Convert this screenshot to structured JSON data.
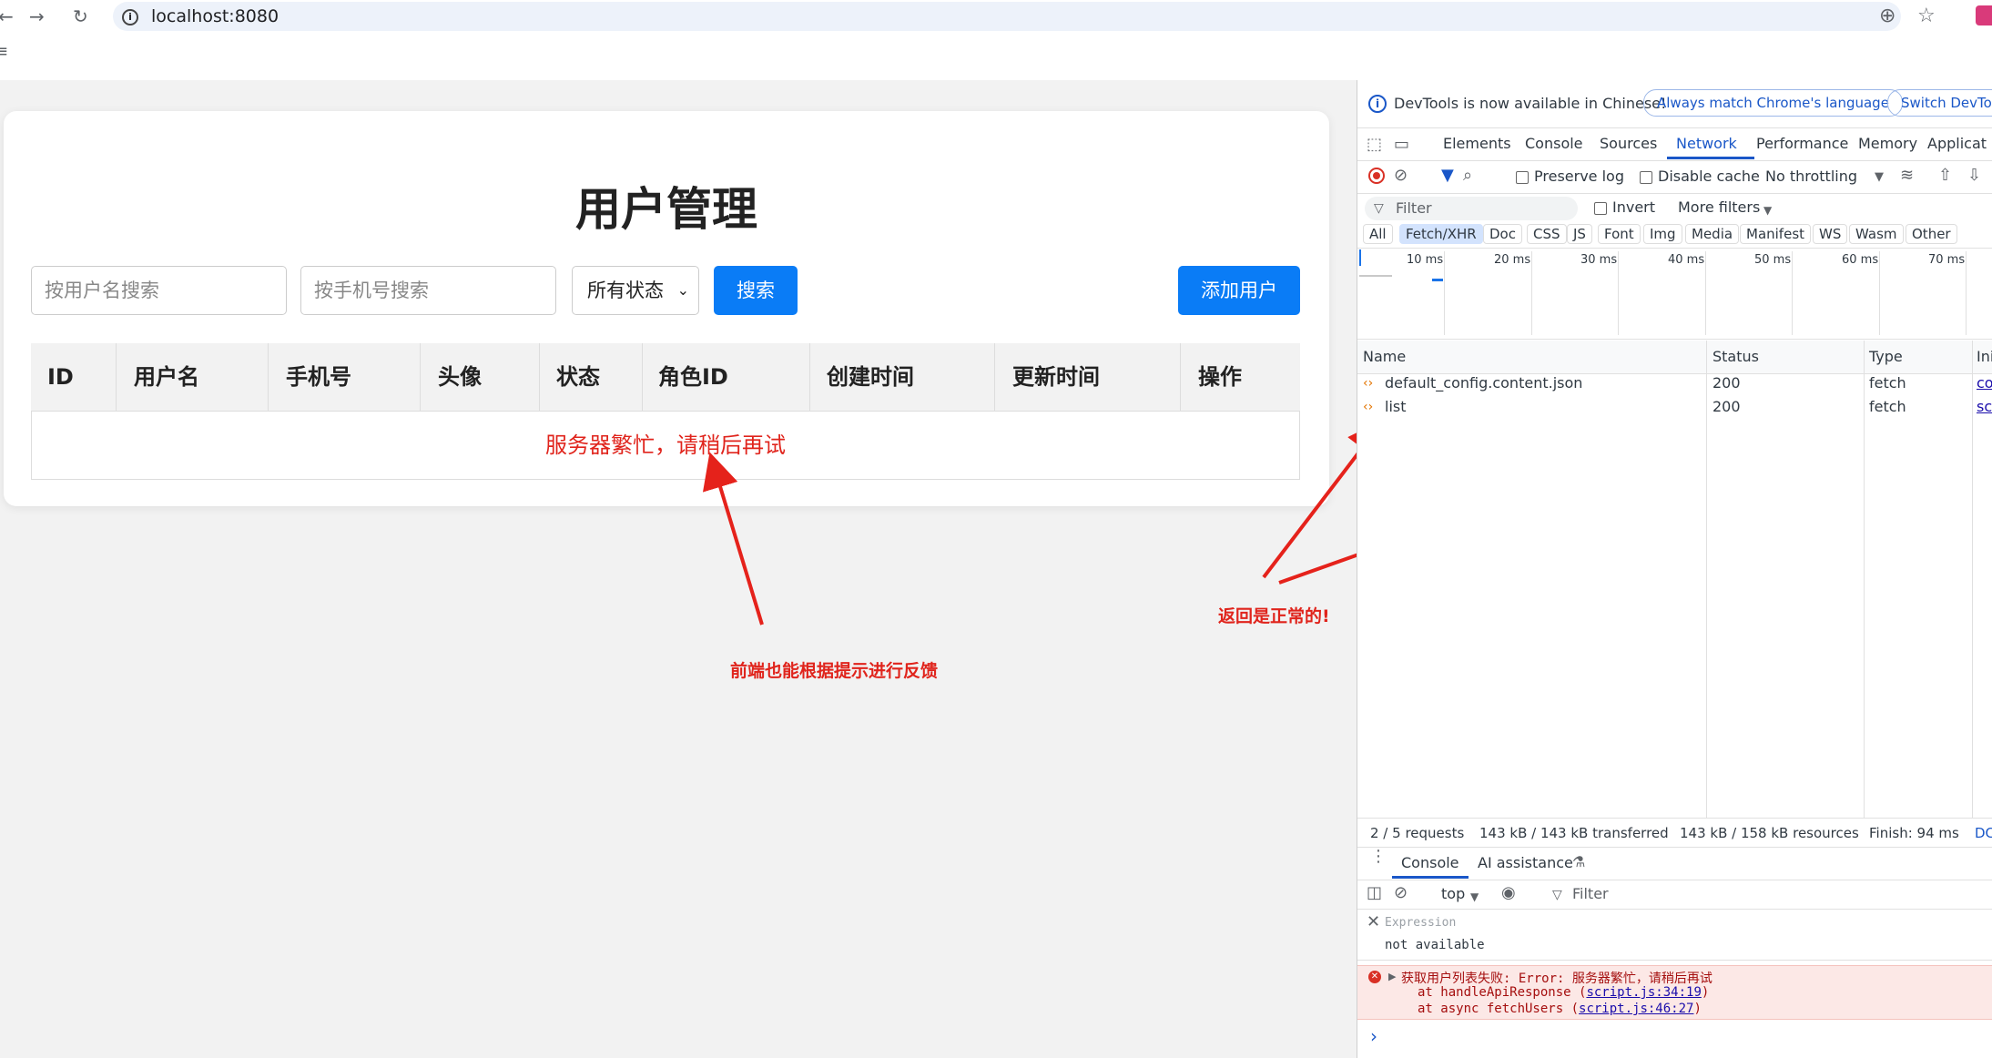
{
  "browser": {
    "url": "localhost:8080",
    "back_glyph": "←",
    "forward_glyph": "→",
    "reload_glyph": "↻",
    "zoom_glyph": "⊕",
    "star_glyph": "☆",
    "menu_glyph": "≡"
  },
  "page": {
    "title": "用户管理",
    "search_username_placeholder": "按用户名搜索",
    "search_phone_placeholder": "按手机号搜索",
    "status_select": "所有状态",
    "search_button": "搜索",
    "add_user_button": "添加用户",
    "columns": [
      "ID",
      "用户名",
      "手机号",
      "头像",
      "状态",
      "角色ID",
      "创建时间",
      "更新时间",
      "操作"
    ],
    "empty_message": "服务器繁忙，请稍后再试"
  },
  "annotations": {
    "frontend_note": "前端也能根据提示进行反馈",
    "response_note": "返回是正常的!"
  },
  "devtools": {
    "banner_text": "DevTools is now available in Chinese!",
    "banner_btn1": "Always match Chrome's language",
    "banner_btn2": "Switch DevToo",
    "tabs": [
      "Elements",
      "Console",
      "Sources",
      "Network",
      "Performance",
      "Memory",
      "Applicat"
    ],
    "active_tab": "Network",
    "preserve_log": "Preserve log",
    "disable_cache": "Disable cache",
    "throttling": "No throttling",
    "filter_placeholder": "Filter",
    "invert": "Invert",
    "more_filters": "More filters",
    "filter_types": [
      "All",
      "Fetch/XHR",
      "Doc",
      "CSS",
      "JS",
      "Font",
      "Img",
      "Media",
      "Manifest",
      "WS",
      "Wasm",
      "Other"
    ],
    "active_filter": "Fetch/XHR",
    "timeline_ticks": [
      "10 ms",
      "20 ms",
      "30 ms",
      "40 ms",
      "50 ms",
      "60 ms",
      "70 ms"
    ],
    "columns": [
      "Name",
      "Status",
      "Type",
      "Ini"
    ],
    "requests": [
      {
        "name": "default_config.content.json",
        "status": "200",
        "type": "fetch",
        "initiator": "co"
      },
      {
        "name": "list",
        "status": "200",
        "type": "fetch",
        "initiator": "sc"
      }
    ],
    "summary": [
      "2 / 5 requests",
      "143 kB / 143 kB transferred",
      "143 kB / 158 kB resources",
      "Finish: 94 ms",
      "DC"
    ],
    "drawer_tabs": [
      "Console",
      "AI assistance"
    ],
    "console_context": "top",
    "console_filter": "Filter",
    "expression_label": "Expression",
    "expression_value": "not available",
    "error_line1": "获取用户列表失败: Error: 服务器繁忙，请稍后再试",
    "error_line2_prefix": "at handleApiResponse (",
    "error_line2_link": "script.js:34:19",
    "error_line3_prefix": "at async fetchUsers (",
    "error_line3_link": "script.js:46:27",
    "close_paren": ")",
    "prompt": "›"
  }
}
